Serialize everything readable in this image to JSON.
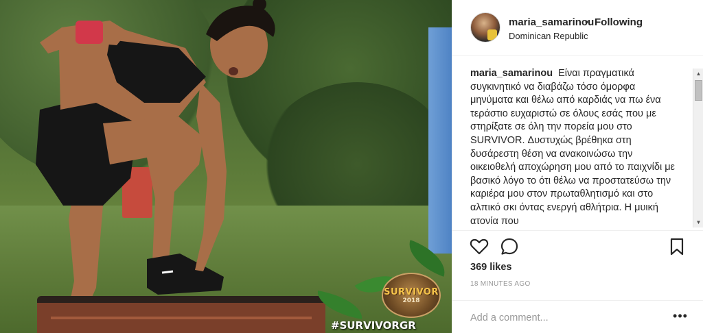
{
  "post": {
    "photo_hashtag": "#SURVIVORGR",
    "emblem_word": "SURVIVOR",
    "emblem_year": "2018"
  },
  "header": {
    "username": "maria_samarinou",
    "separator": "•",
    "follow_state": "Following",
    "location": "Dominican Republic"
  },
  "caption": {
    "username": "maria_samarinou",
    "text": "Είναι πραγματικά συγκινητικό να διαβάζω τόσο όμορφα μηνύματα και θέλω από καρδιάς να πω ένα τεράστιο ευχαριστώ σε όλους εσάς που με στηρίξατε σε όλη την πορεία μου στο SURVIVOR. Δυστυχώς βρέθηκα στη δυσάρεστη θέση να ανακοινώσω την οικειοθελή αποχώρηση μου από το παιχνίδι με βασικό λόγο το ότι θέλω να προστατεύσω την καριέρα μου στον πρωταθλητισμό και στο αλπικό σκι όντας ενεργή αθλήτρια. Η μυική ατονία που"
  },
  "actions": {
    "like_icon": "heart-icon",
    "comment_icon": "comment-icon",
    "save_icon": "bookmark-icon"
  },
  "stats": {
    "likes": "369 likes",
    "timestamp": "18 MINUTES AGO"
  },
  "comment_box": {
    "placeholder": "Add a comment...",
    "more_label": "•••"
  },
  "scrollbar": {
    "up_glyph": "▲",
    "down_glyph": "▼"
  }
}
